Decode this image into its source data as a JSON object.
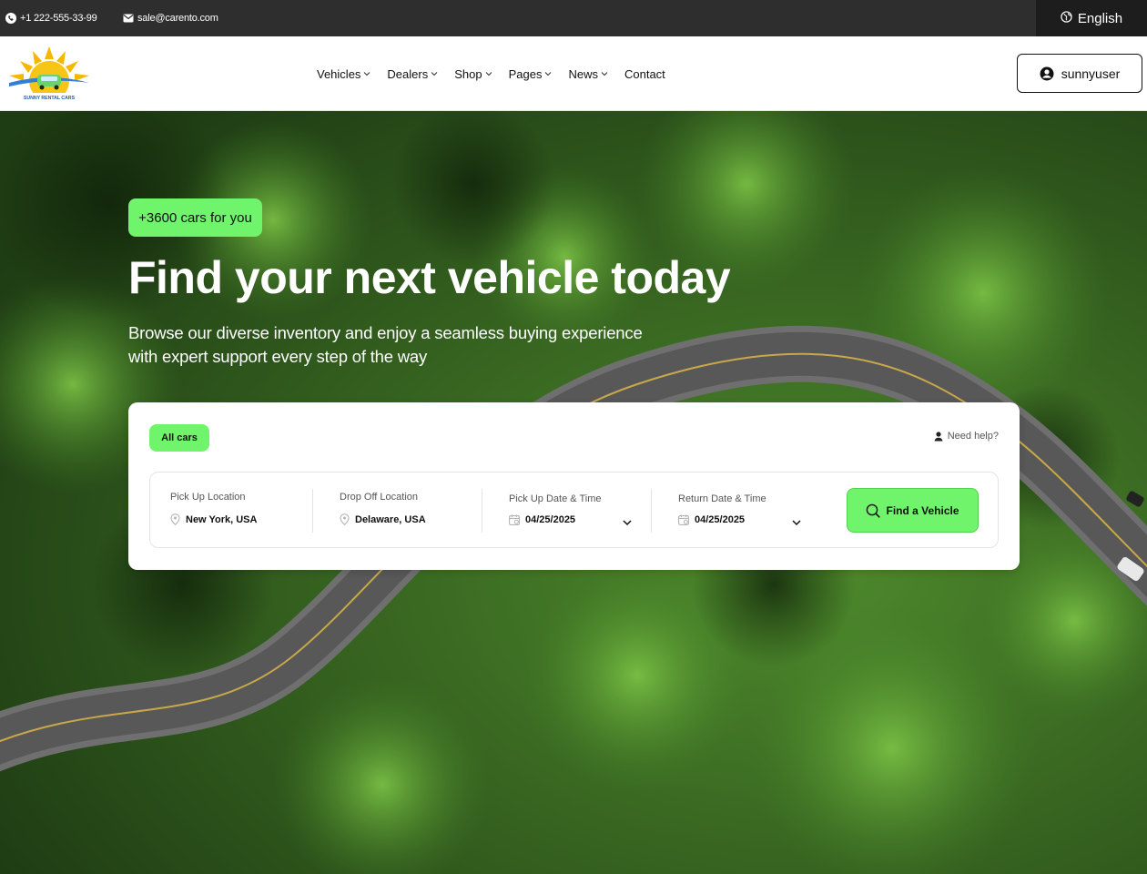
{
  "topbar": {
    "phone": "+1 222-555-33-99",
    "email": "sale@carento.com",
    "language": "English",
    "icons": {
      "phone": "phone-icon",
      "email": "mail-icon",
      "language": "globe-icon"
    }
  },
  "header": {
    "logo_text": "SUNNY RENTAL CARS",
    "nav": [
      {
        "label": "Vehicles",
        "has_dropdown": true
      },
      {
        "label": "Dealers",
        "has_dropdown": true
      },
      {
        "label": "Shop",
        "has_dropdown": true
      },
      {
        "label": "Pages",
        "has_dropdown": true
      },
      {
        "label": "News",
        "has_dropdown": true
      },
      {
        "label": "Contact",
        "has_dropdown": false
      }
    ],
    "user": {
      "name": "sunnyuser",
      "icon": "user-circle-icon"
    }
  },
  "hero": {
    "badge": "+3600 cars for you",
    "title": "Find your next vehicle today",
    "subtitle_line1": "Browse our diverse inventory and enjoy a seamless buying experience",
    "subtitle_line2": "with expert support every step of the way"
  },
  "search": {
    "tab_all": "All cars",
    "need_help": "Need help?",
    "pickup_location": {
      "label": "Pick Up Location",
      "value": "New York, USA"
    },
    "dropoff_location": {
      "label": "Drop Off Location",
      "value": "Delaware, USA"
    },
    "pickup_date": {
      "label": "Pick Up Date & Time",
      "value": "04/25/2025"
    },
    "return_date": {
      "label": "Return Date & Time",
      "value": "04/25/2025"
    },
    "find_button": "Find a Vehicle"
  },
  "colors": {
    "accent_green": "#70f46b",
    "topbar_bg": "#2e2e2e",
    "lang_bg": "#1d1d1d"
  }
}
